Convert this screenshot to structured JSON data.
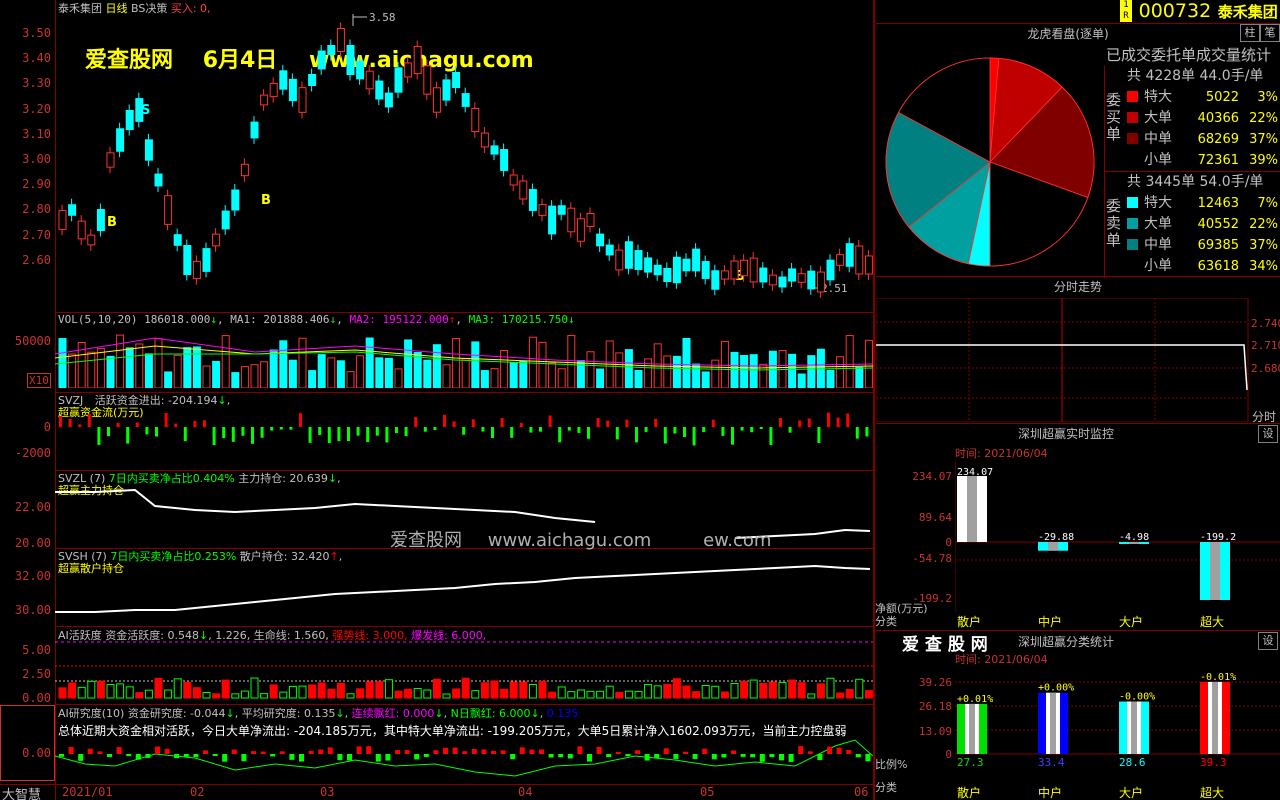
{
  "app": {
    "brand": "大智慧"
  },
  "main": {
    "header": {
      "name": "泰禾集团",
      "period": "日线",
      "indicator": "BS决策",
      "buy": "买入: 0,"
    },
    "yticks": [
      "3.50",
      "3.40",
      "3.30",
      "3.20",
      "3.10",
      "3.00",
      "2.90",
      "2.80",
      "2.70",
      "2.60"
    ],
    "high_label": "3.58",
    "low_label": "2.51",
    "watermark": {
      "site": "爱查股网",
      "date": "6月4日",
      "url": "www.aichagu.com"
    },
    "signals": [
      "S",
      "B",
      "B",
      "B"
    ],
    "center_watermark": {
      "site": "爱查股网",
      "url": "www.aichagu.com",
      "tail": "ew.com"
    },
    "bottom_watermark": "爱 查 股 网"
  },
  "vol": {
    "title": "VOL(5,10,20)",
    "value": "186018.000",
    "ma1": "MA1: 201888.406",
    "ma2": "MA2: 195122.000",
    "ma3": "MA3: 170215.750",
    "ytick": "50000",
    "unit": "X10"
  },
  "svzj": {
    "title": "SVZJ",
    "line1": "活跃资金进出: -204.194",
    "line2": "超赢资金流(万元)",
    "yticks": [
      "0",
      "-2000"
    ]
  },
  "svzl": {
    "title": "SVZL (7)",
    "line1": "7日内买卖净占比0.404%",
    "line2": "主力持仓: 20.639",
    "line3": "超赢主力持仓",
    "yticks": [
      "22.00",
      "20.00"
    ]
  },
  "svsh": {
    "title": "SVSH (7)",
    "line1": "7日内买卖净占比0.253%",
    "line2": "散户持仓: 32.420",
    "line3": "超赢散户持仓",
    "yticks": [
      "32.00",
      "30.00"
    ]
  },
  "ai": {
    "title": "AI活跃度",
    "l1": "资金活跃度: 0.548",
    "l2": "1.226,",
    "l3": "生命线: 1.560,",
    "l4": "强势线: 3.000,",
    "l5": "爆发线: 6.000,",
    "yticks": [
      "5.00",
      "2.50",
      "0.00"
    ]
  },
  "research": {
    "title": "AI研究度(10)",
    "l1": "资金研究度: -0.044",
    "l2": "平均研究度: 0.135",
    "l3": "连续飘红: 0.000",
    "l4": "N日飘红: 6.000",
    "l5": "0.135",
    "summary": "总体近期大资金相对活跃，今日大单净流出: -204.185万元，其中特大单净流出: -199.205万元，大单5日累计净入1602.093万元，当前主力控盘弱",
    "ytick": "0.00"
  },
  "xaxis": [
    "2021/01",
    "02",
    "03",
    "04",
    "05",
    "06"
  ],
  "right": {
    "code": "000732",
    "name": "泰禾集团",
    "btn1": "柱",
    "btn2": "笔",
    "pie_title": "龙虎看盘(逐单)",
    "stats_title": "已成交委托单成交量统计",
    "buy": {
      "label": "委买单",
      "total": "共 4228单 44.0手/单",
      "rows": [
        {
          "name": "特大",
          "count": "5022",
          "pct": "3%",
          "color": "#ff0000"
        },
        {
          "name": "大单",
          "count": "40366",
          "pct": "22%",
          "color": "#c00000"
        },
        {
          "name": "中单",
          "count": "68269",
          "pct": "37%",
          "color": "#800000"
        },
        {
          "name": "小单",
          "count": "72361",
          "pct": "39%",
          "color": "#000000"
        }
      ]
    },
    "sell": {
      "label": "委卖单",
      "total": "共 3445单 54.0手/单",
      "rows": [
        {
          "name": "特大",
          "count": "12463",
          "pct": "7%",
          "color": "#00ffff"
        },
        {
          "name": "大单",
          "count": "40552",
          "pct": "22%",
          "color": "#00a0a0"
        },
        {
          "name": "中单",
          "count": "69385",
          "pct": "37%",
          "color": "#008080"
        },
        {
          "name": "小单",
          "count": "63618",
          "pct": "34%",
          "color": "#000000"
        }
      ]
    },
    "intraday": {
      "title": "分时走势",
      "yticks": [
        "2.740",
        "2.710",
        "2.680"
      ],
      "corner": "分时"
    },
    "monitor": {
      "title": "深圳超赢实时监控",
      "btn": "设",
      "time": "时间: 2021/06/04",
      "yticks": [
        "234.07",
        "89.64",
        "0",
        "-54.78",
        "-199.2"
      ],
      "ylabel": "净额(万元)",
      "xlabel": "分类",
      "bars": [
        {
          "cat": "散户",
          "value": "234.07"
        },
        {
          "cat": "中户",
          "value": "-29.88"
        },
        {
          "cat": "大户",
          "value": "-4.98"
        },
        {
          "cat": "超大",
          "value": "-199.2"
        }
      ]
    },
    "stats": {
      "title": "深圳超赢分类统计",
      "btn": "设",
      "time": "时间: 2021/06/04",
      "yticks": [
        "39.26",
        "26.18",
        "13.09",
        "0"
      ],
      "ylabel": "比例%",
      "xlabel": "分类",
      "bars": [
        {
          "cat": "散户",
          "pct": "27.3",
          "chg": "+0.01%",
          "color": "#00e000"
        },
        {
          "cat": "中户",
          "pct": "33.4",
          "chg": "+0.00%",
          "color": "#0000ff"
        },
        {
          "cat": "大户",
          "pct": "28.6",
          "chg": "-0.00%",
          "color": "#00ffff"
        },
        {
          "cat": "超大",
          "pct": "39.3",
          "chg": "-0.01%",
          "color": "#ff0000"
        }
      ]
    }
  },
  "chart_data": [
    {
      "type": "pie",
      "title": "龙虎看盘(逐单)",
      "categories": [
        "委买特大",
        "委买大单",
        "委买中单",
        "委买小单",
        "委卖特大",
        "委卖大单",
        "委卖中单",
        "委卖小单"
      ],
      "values": [
        5022,
        40366,
        68269,
        72361,
        12463,
        40552,
        69385,
        63618
      ]
    },
    {
      "type": "bar",
      "title": "深圳超赢实时监控",
      "categories": [
        "散户",
        "中户",
        "大户",
        "超大"
      ],
      "values": [
        234.07,
        -29.88,
        -4.98,
        -199.2
      ],
      "ylabel": "净额(万元)",
      "ylim": [
        -199.2,
        234.07
      ]
    },
    {
      "type": "bar",
      "title": "深圳超赢分类统计",
      "categories": [
        "散户",
        "中户",
        "大户",
        "超大"
      ],
      "values": [
        27.3,
        33.4,
        28.6,
        39.3
      ],
      "ylabel": "比例%",
      "ylim": [
        0,
        39.26
      ]
    }
  ]
}
